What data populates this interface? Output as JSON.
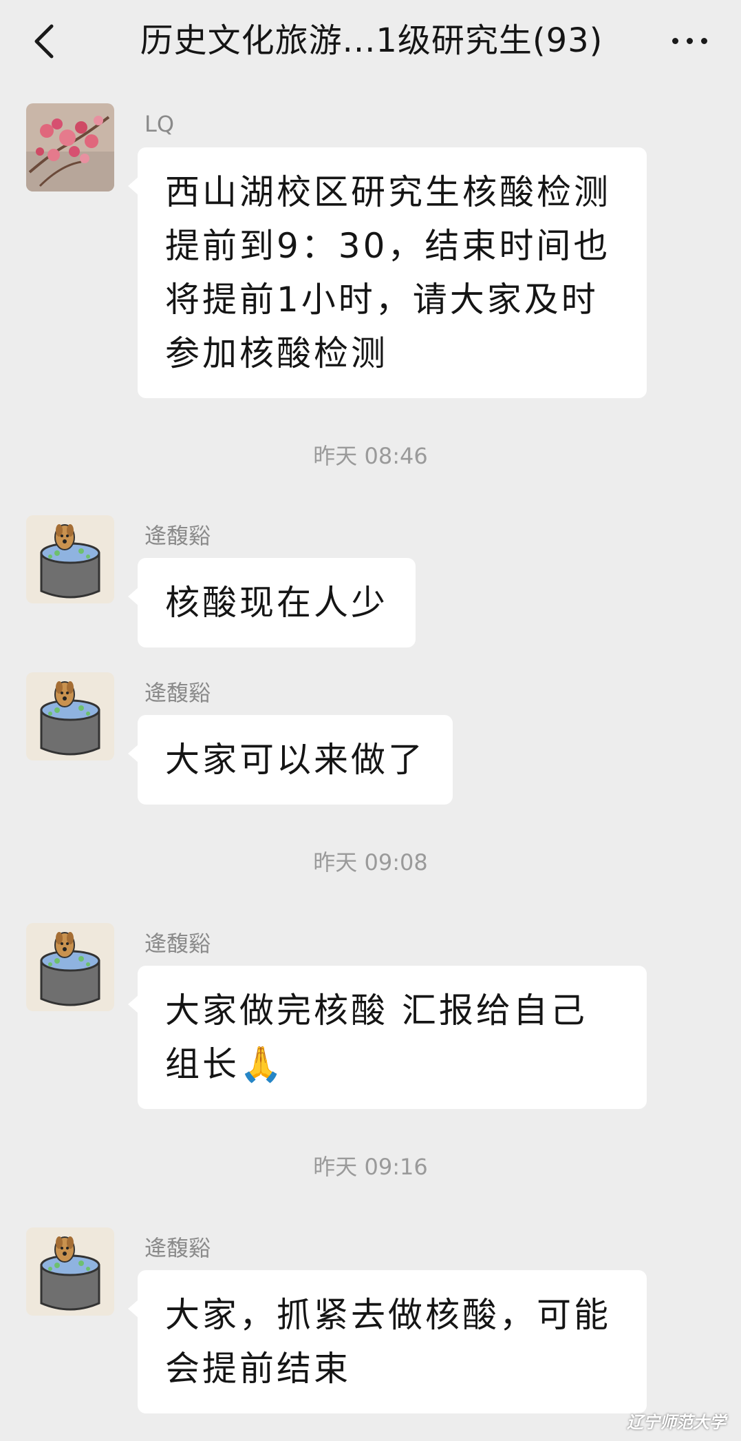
{
  "header": {
    "title": "历史文化旅游...1级研究生(93)",
    "back_icon": "chevron-left-icon",
    "more_icon": "more-dots-icon"
  },
  "messages": [
    {
      "sender": "LQ",
      "avatar": "flower-avatar",
      "text": "西山湖校区研究生核酸检测提前到9：30，结束时间也将提前1小时，请大家及时参加核酸检测"
    },
    {
      "timestamp": "昨天 08:46"
    },
    {
      "sender": "逄馥谿",
      "avatar": "dog-in-bucket-avatar",
      "text": "核酸现在人少"
    },
    {
      "sender": "逄馥谿",
      "avatar": "dog-in-bucket-avatar",
      "text": "大家可以来做了"
    },
    {
      "timestamp": "昨天 09:08"
    },
    {
      "sender": "逄馥谿",
      "avatar": "dog-in-bucket-avatar",
      "text": "大家做完核酸 汇报给自己组长🙏"
    },
    {
      "timestamp": "昨天 09:16"
    },
    {
      "sender": "逄馥谿",
      "avatar": "dog-in-bucket-avatar",
      "text": "大家，抓紧去做核酸，可能会提前结束"
    }
  ],
  "watermark": "辽宁师范大学"
}
